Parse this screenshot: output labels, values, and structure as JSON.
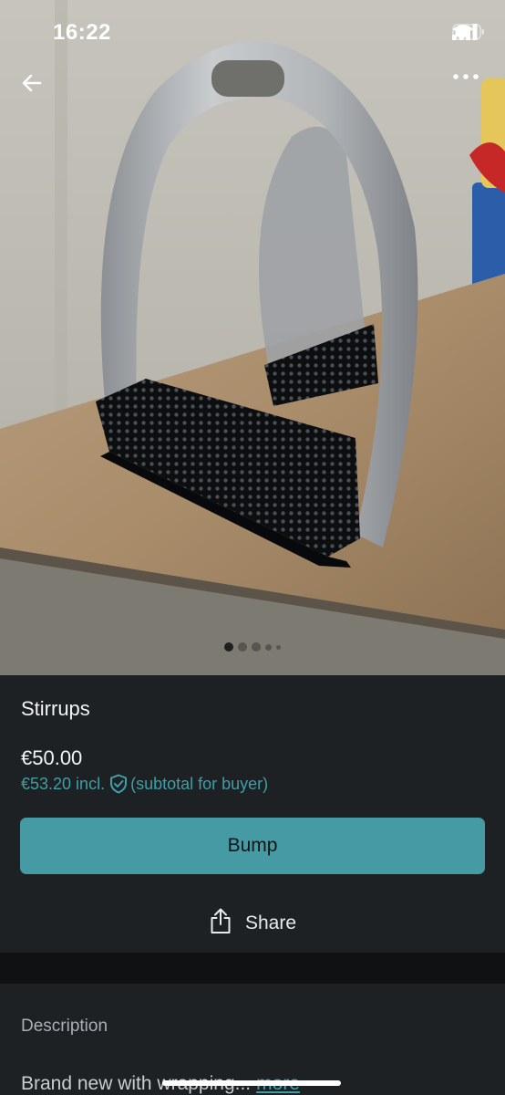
{
  "status_bar": {
    "time": "16:22",
    "icons": [
      "signal-icon",
      "wifi-icon",
      "battery-icon"
    ]
  },
  "nav": {
    "back_icon": "arrow-left-icon",
    "more_icon": "more-horizontal-icon"
  },
  "gallery": {
    "image_subject": "stirrups-photo",
    "page_count": 5,
    "active_index": 0
  },
  "item": {
    "title": "Stirrups",
    "price": "€50.00",
    "buyer_price": "€53.20 incl.",
    "buyer_price_note": "(subtotal for buyer)"
  },
  "actions": {
    "bump_label": "Bump",
    "share_label": "Share",
    "share_icon": "share-icon"
  },
  "description": {
    "heading": "Description",
    "text": "Brand new with wrapping...",
    "more_label": "more"
  },
  "colors": {
    "accent": "#469aa3",
    "accent_text": "#3e9fa7",
    "panel_bg": "#1d2124",
    "page_bg": "#0f1112"
  }
}
